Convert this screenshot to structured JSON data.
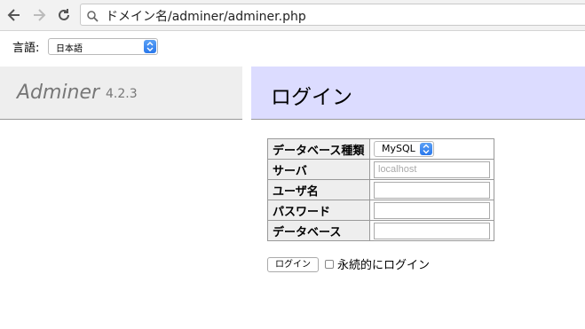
{
  "browser": {
    "url": "ドメイン名/adminer/adminer.php",
    "icons": [
      "back-arrow-icon",
      "forward-arrow-icon",
      "reload-icon",
      "search-icon"
    ]
  },
  "language": {
    "label": "言語:",
    "selected": "日本語"
  },
  "header": {
    "brand": "Adminer",
    "version": "4.2.3",
    "title": "ログイン",
    "colors": {
      "brand_bg": "#eeeeee",
      "title_bg": "#dcdcff"
    }
  },
  "form": {
    "system_label": "データベース種類",
    "system_value": "MySQL",
    "server_label": "サーバ",
    "server_placeholder": "localhost",
    "username_label": "ユーザ名",
    "password_label": "パスワード",
    "database_label": "データベース",
    "submit_label": "ログイン",
    "permanent_label": "永続的にログイン"
  }
}
